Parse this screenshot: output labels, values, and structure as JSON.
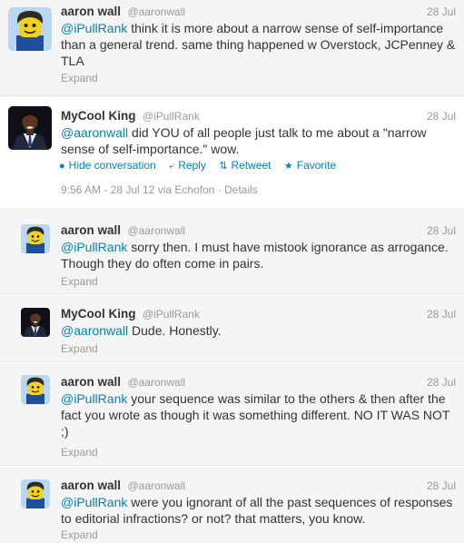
{
  "tweets": [
    {
      "name": "aaron wall",
      "handle": "@aaronwall",
      "time": "28 Jul",
      "mention": "@iPullRank",
      "text": " think it is more about a narrow sense of self-importance than a general trend. same thing happened w Overstock, JCPenney & TLA",
      "expand": "Expand"
    },
    {
      "name": "MyCool King",
      "handle": "@iPullRank",
      "time": "28 Jul",
      "mention": "@aaronwall",
      "text": " did YOU of all people just talk to me about a \"narrow sense of self-importance.\" wow.",
      "actions": {
        "hide": "Hide conversation",
        "reply": "Reply",
        "retweet": "Retweet",
        "favorite": "Favorite"
      },
      "timestamp": "9:56 AM - 28 Jul 12 via Echofon",
      "details": "Details"
    },
    {
      "name": "aaron wall",
      "handle": "@aaronwall",
      "time": "28 Jul",
      "mention": "@iPullRank",
      "text": " sorry then. I must have mistook ignorance as arrogance. Though they do often come in pairs.",
      "expand": "Expand"
    },
    {
      "name": "MyCool King",
      "handle": "@iPullRank",
      "time": "28 Jul",
      "mention": "@aaronwall",
      "text": " Dude. Honestly.",
      "expand": "Expand"
    },
    {
      "name": "aaron wall",
      "handle": "@aaronwall",
      "time": "28 Jul",
      "mention": "@iPullRank",
      "text": " your sequence was similar to the others & then after the fact you wrote as though it was something different. NO IT WAS NOT ;)",
      "expand": "Expand"
    },
    {
      "name": "aaron wall",
      "handle": "@aaronwall",
      "time": "28 Jul",
      "mention": "@iPullRank",
      "text": " were you ignorant of all the past sequences of responses to editorial infractions? or not? that matters, you know.",
      "expand": "Expand"
    }
  ],
  "colors": {
    "link": "#0084b4",
    "muted": "#999999",
    "text": "#333333",
    "replies_background": "#f5f5f5"
  },
  "icons": {
    "hide": "bubble-icon",
    "reply": "reply-arrow-icon",
    "retweet": "retweet-icon",
    "favorite": "star-icon"
  }
}
